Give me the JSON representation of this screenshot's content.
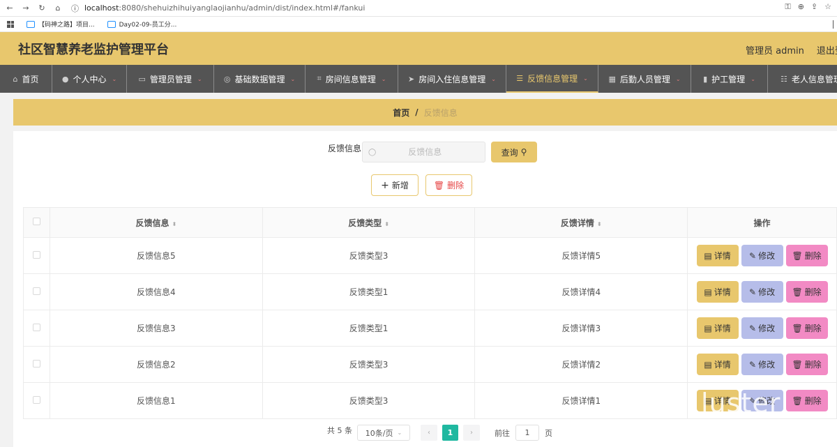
{
  "browser": {
    "url_host": "localhost",
    "url_path": ":8080/shehuizhihuiyanglaojianhu/admin/dist/index.html#/fankui",
    "bookmarks": [
      {
        "label": "【码神之路】项目..."
      },
      {
        "label": "Day02-09-员工分..."
      }
    ]
  },
  "header": {
    "title": "社区智慧养老监护管理平台",
    "user_label": "管理员 admin",
    "logout_label": "退出登"
  },
  "nav": {
    "items": [
      {
        "label": "首页",
        "icon": "home-icon",
        "caret": false
      },
      {
        "label": "个人中心",
        "icon": "user-icon",
        "caret": true
      },
      {
        "label": "管理员管理",
        "icon": "monitor-icon",
        "caret": true
      },
      {
        "label": "基础数据管理",
        "icon": "gear-icon",
        "caret": true
      },
      {
        "label": "房间信息管理",
        "icon": "crop-icon",
        "caret": true
      },
      {
        "label": "房间入住信息管理",
        "icon": "send-icon",
        "caret": true
      },
      {
        "label": "反馈信息管理",
        "icon": "menu-icon",
        "caret": true,
        "active": true
      },
      {
        "label": "后勤人员管理",
        "icon": "grid-icon",
        "caret": true
      },
      {
        "label": "护工管理",
        "icon": "chart-icon",
        "caret": true
      },
      {
        "label": "老人信息管理",
        "icon": "sliders-icon",
        "caret": false
      }
    ]
  },
  "breadcrumb": {
    "home": "首页",
    "separator": "/",
    "current": "反馈信息"
  },
  "search": {
    "label": "反馈信息",
    "placeholder": "反馈信息",
    "query_label": "查询"
  },
  "actions": {
    "add_label": "新增",
    "delete_label": "删除"
  },
  "table": {
    "columns": [
      "反馈信息",
      "反馈类型",
      "反馈详情",
      "操作"
    ],
    "rows": [
      {
        "info": "反馈信息5",
        "type": "反馈类型3",
        "detail": "反馈详情5"
      },
      {
        "info": "反馈信息4",
        "type": "反馈类型1",
        "detail": "反馈详情4"
      },
      {
        "info": "反馈信息3",
        "type": "反馈类型1",
        "detail": "反馈详情3"
      },
      {
        "info": "反馈信息2",
        "type": "反馈类型3",
        "detail": "反馈详情2"
      },
      {
        "info": "反馈信息1",
        "type": "反馈类型3",
        "detail": "反馈详情1"
      }
    ],
    "row_actions": {
      "detail_label": "详情",
      "edit_label": "修改",
      "delete_label": "删除"
    }
  },
  "pagination": {
    "total_label": "共 5 条",
    "page_size_label": "10条/页",
    "current_page": "1",
    "goto_prefix": "前往",
    "goto_value": "1",
    "goto_suffix": "页"
  },
  "watermark": "luster",
  "colors": {
    "accent": "#e8c76d",
    "nav_bg": "#545454",
    "edit": "#b6bde9",
    "delete": "#f28ac4",
    "page_active": "#1fb8a0"
  }
}
